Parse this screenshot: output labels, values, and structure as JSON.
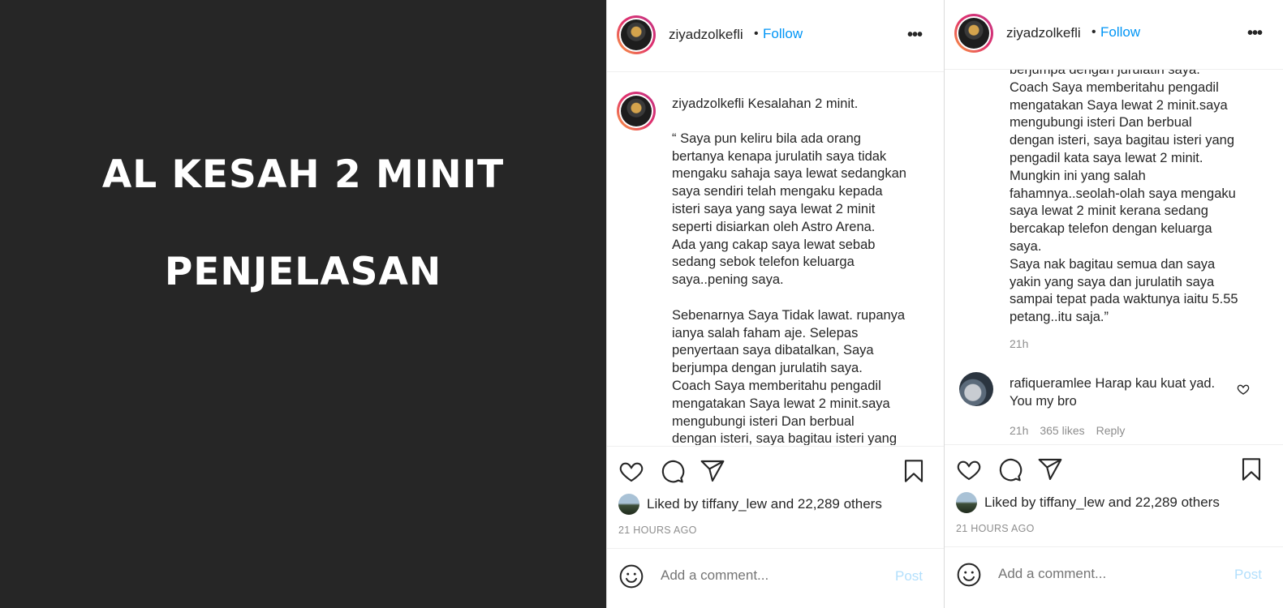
{
  "image": {
    "line1": "AL KESAH 2 MINIT",
    "line2": "PENJELASAN"
  },
  "panel_a": {
    "header": {
      "username": "ziyadzolkefli",
      "dot": "•",
      "follow": "Follow",
      "more": "•••"
    },
    "caption": {
      "username": "ziyadzolkefli",
      "title": " Kesalahan 2 minit.",
      "lines": [
        "“ Saya pun keliru bila ada orang",
        "bertanya kenapa jurulatih saya tidak",
        "mengaku sahaja saya lewat sedangkan",
        "saya sendiri telah mengaku kepada",
        "isteri saya yang saya lewat 2 minit",
        "seperti disiarkan oleh Astro Arena.",
        "Ada yang cakap saya lewat sebab",
        "sedang sebok telefon keluarga",
        "saya..pening saya.",
        "",
        "Sebenarnya Saya Tidak lawat. rupanya",
        "ianya salah faham aje. Selepas",
        "penyertaan saya dibatalkan, Saya",
        "berjumpa dengan jurulatih saya.",
        "Coach Saya memberitahu pengadil",
        "mengatakan Saya lewat 2 minit.saya",
        "mengubungi isteri Dan berbual",
        "dengan isteri, saya bagitau isteri yang"
      ]
    },
    "liked": {
      "prefix": "Liked by ",
      "user": "tiffany_lew",
      "mid": " and ",
      "others": "22,289 others"
    },
    "timestamp": "21 HOURS AGO",
    "add_comment": {
      "placeholder": "Add a comment...",
      "post": "Post"
    }
  },
  "panel_b": {
    "header": {
      "username": "ziyadzolkefli",
      "dot": "•",
      "follow": "Follow",
      "more": "•••"
    },
    "caption_lines": [
      "berjumpa dengan jurulatih saya.",
      "Coach Saya memberitahu pengadil",
      "mengatakan Saya lewat 2 minit.saya",
      "mengubungi isteri Dan berbual",
      "dengan isteri, saya bagitau isteri yang",
      "pengadil kata saya lewat 2 minit.",
      "Mungkin ini yang salah",
      "fahamnya..seolah-olah saya mengaku",
      "saya lewat 2 minit kerana sedang",
      "bercakap telefon dengan keluarga",
      "saya.",
      "Saya nak bagitau semua dan saya",
      "yakin yang saya dan jurulatih saya",
      "sampai tepat pada waktunya iaitu 5.55",
      "petang..itu saja.”"
    ],
    "caption_time": "21h",
    "comment": {
      "username": "rafiqueramlee",
      "text": " Harap kau kuat yad. You my bro",
      "time": "21h",
      "likes": "365 likes",
      "reply": "Reply"
    },
    "liked": {
      "prefix": "Liked by ",
      "user": "tiffany_lew",
      "mid": " and ",
      "others": "22,289 others"
    },
    "timestamp": "21 HOURS AGO",
    "add_comment": {
      "placeholder": "Add a comment...",
      "post": "Post"
    }
  },
  "colors": {
    "link_blue": "#0095f6",
    "post_disabled": "#b2dffc",
    "image_bg": "#262626",
    "muted": "#8e8e8e"
  },
  "icons": [
    "heart-icon",
    "comment-icon",
    "share-icon",
    "bookmark-icon",
    "emoji-icon",
    "more-options-icon"
  ]
}
